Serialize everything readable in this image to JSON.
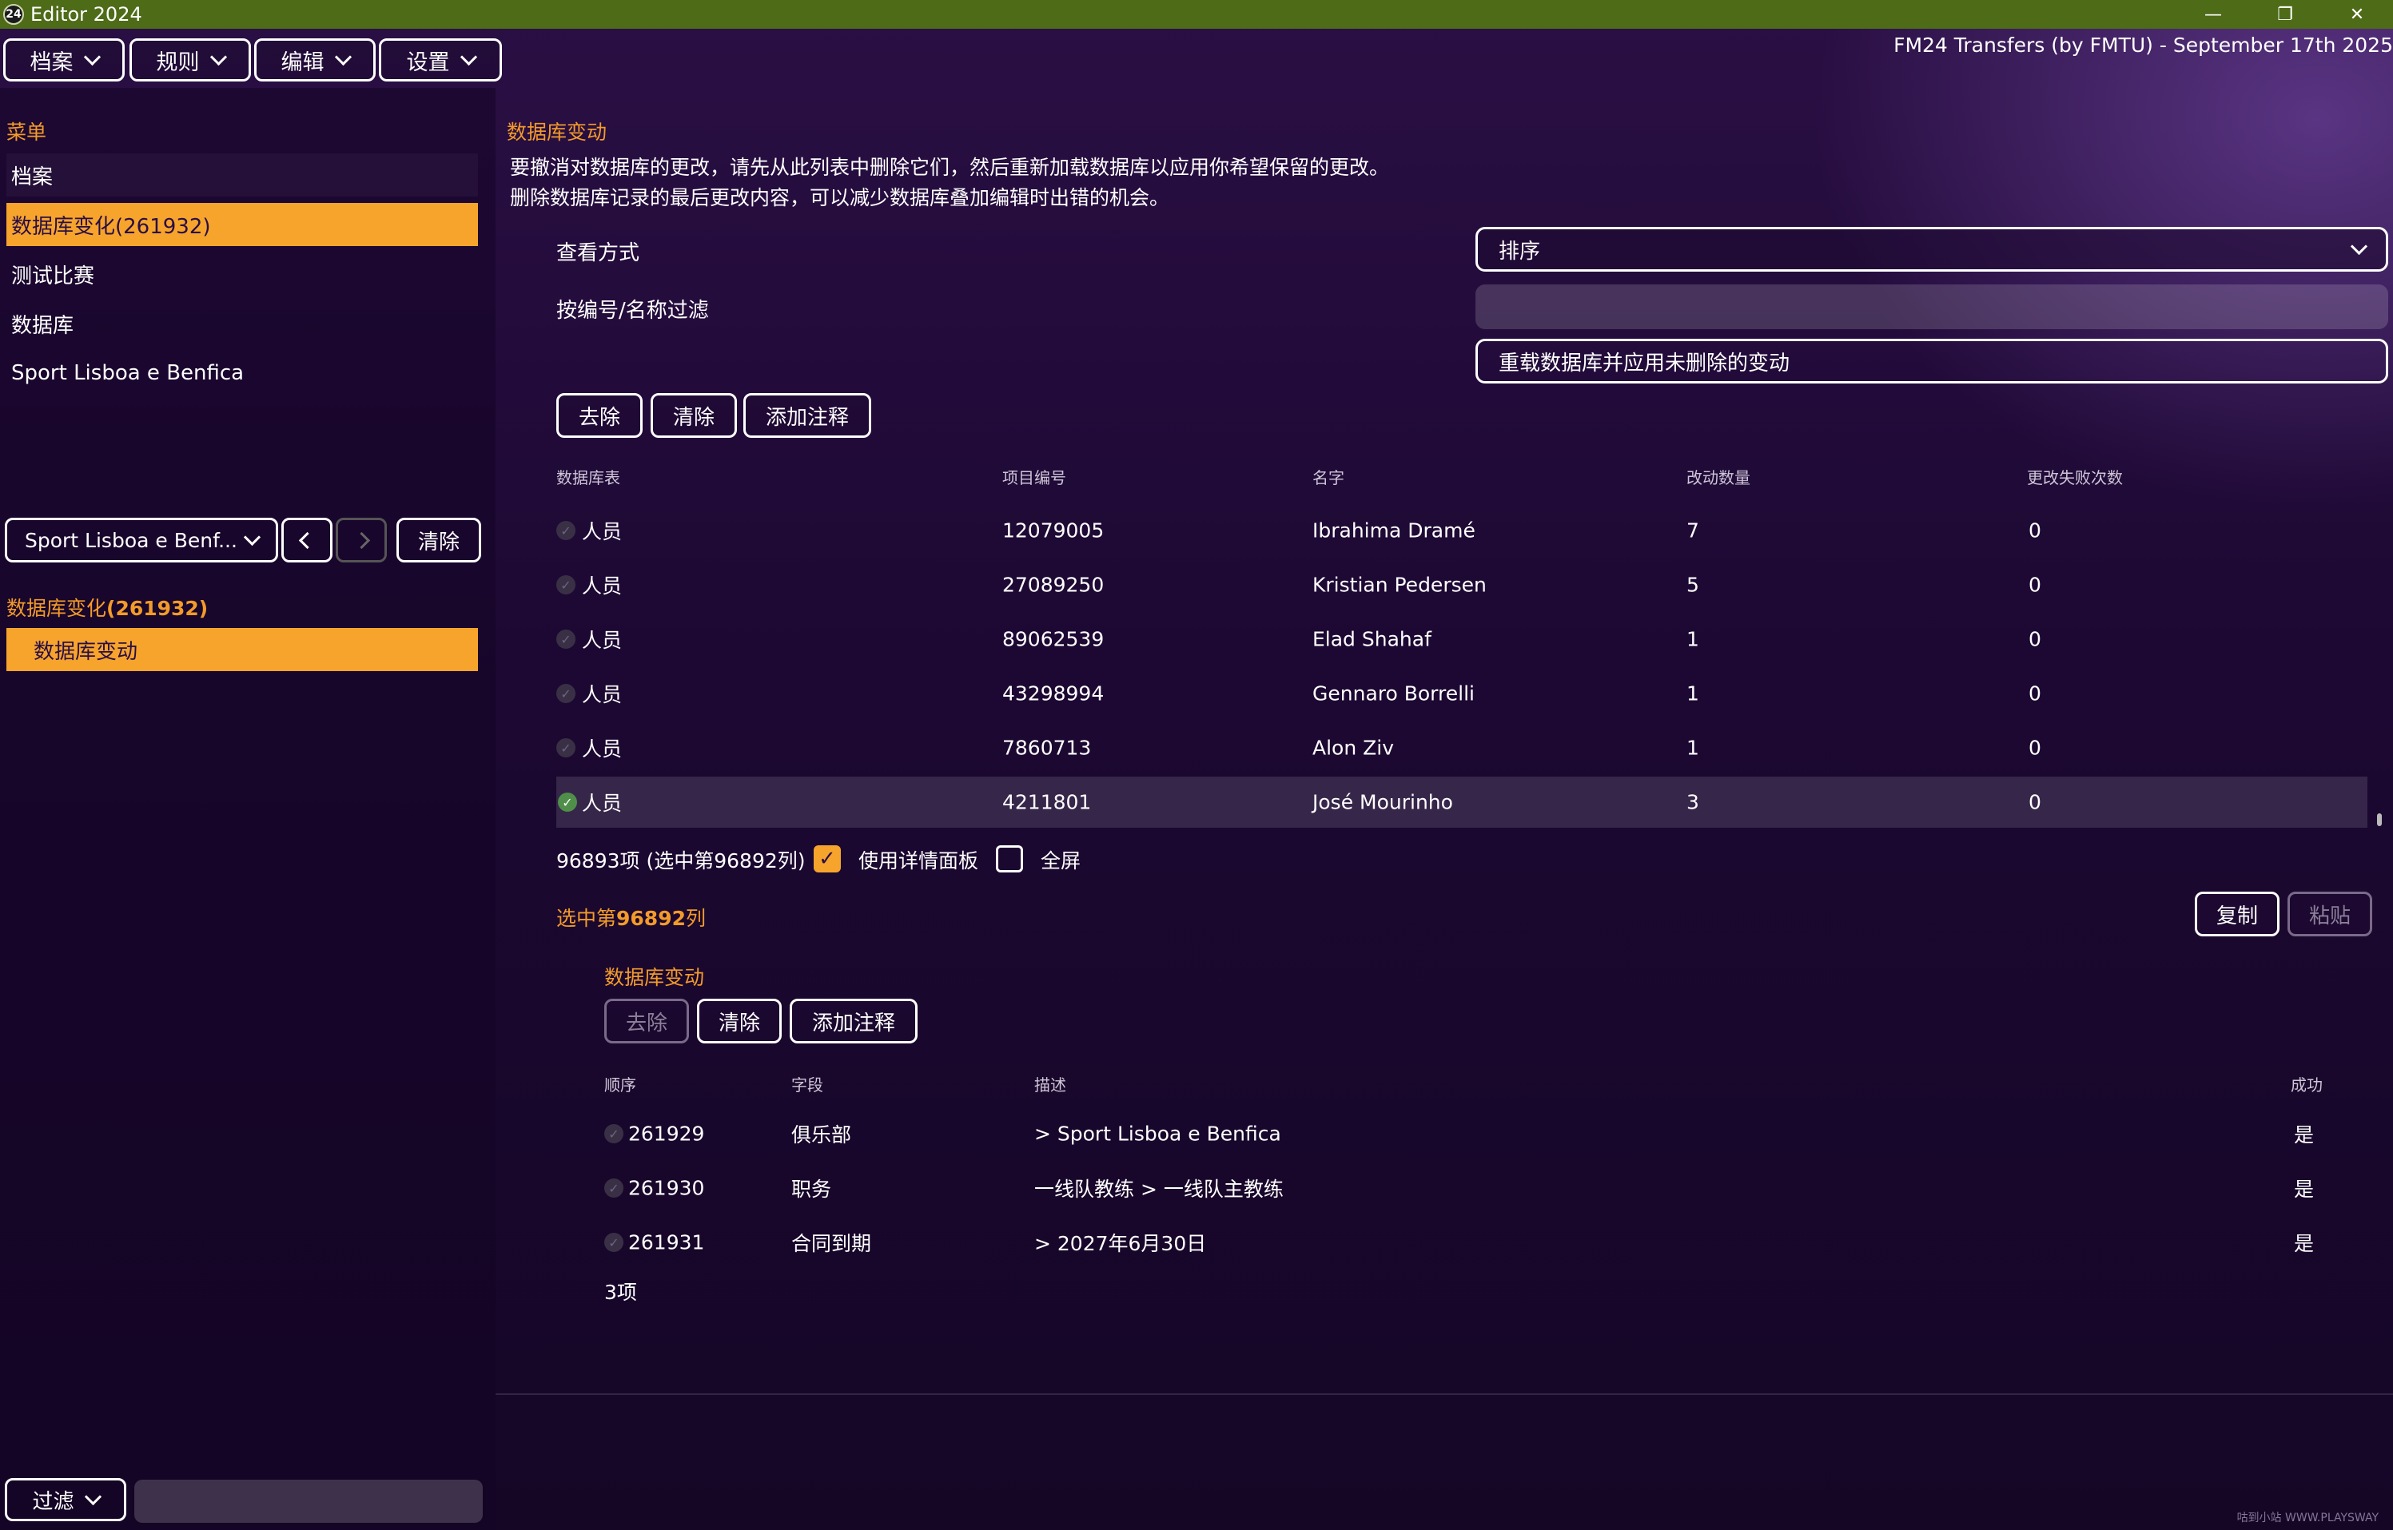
{
  "window": {
    "icon_text": "24",
    "title": "Editor 2024",
    "controls": [
      "—",
      "❐",
      "✕"
    ]
  },
  "menus": [
    {
      "label": "档案"
    },
    {
      "label": "规则"
    },
    {
      "label": "编辑"
    },
    {
      "label": "设置"
    }
  ],
  "header_right": "FM24 Transfers (by FMTU) - September 17th 2025",
  "sidebar": {
    "menu_title": "菜单",
    "items": [
      {
        "label": "档案"
      },
      {
        "label": "数据库变化(261932)"
      },
      {
        "label": "测试比赛"
      },
      {
        "label": "数据库"
      },
      {
        "label": "Sport Lisboa e Benfica"
      }
    ],
    "nav_select": "Sport Lisboa e Benf...",
    "clear_label": "清除",
    "history_title": "数据库变化",
    "history_count": "(261932)",
    "history_item": "数据库变动",
    "filter_label": "过滤"
  },
  "main": {
    "title": "数据库变动",
    "desc_line1": "要撤消对数据库的更改，请先从此列表中删除它们，然后重新加载数据库以应用你希望保留的更改。",
    "desc_line2": "删除数据库记录的最后更改内容，可以减少数据库叠加编辑时出错的机会。",
    "view_label": "查看方式",
    "view_value": "排序",
    "filter_label": "按编号/名称过滤",
    "filter_value": "",
    "reload_label": "重载数据库并应用未删除的变动",
    "buttons": {
      "remove": "去除",
      "clear": "清除",
      "add_note": "添加注释"
    },
    "table": {
      "headers": [
        "数据库表",
        "项目编号",
        "名字",
        "改动数量",
        "更改失败次数"
      ],
      "rows": [
        {
          "table": "人员",
          "id": "12079005",
          "name": "Ibrahima Dramé",
          "changes": "7",
          "failures": "0"
        },
        {
          "table": "人员",
          "id": "27089250",
          "name": "Kristian Pedersen",
          "changes": "5",
          "failures": "0"
        },
        {
          "table": "人员",
          "id": "89062539",
          "name": "Elad Shahaf",
          "changes": "1",
          "failures": "0"
        },
        {
          "table": "人员",
          "id": "43298994",
          "name": "Gennaro Borrelli",
          "changes": "1",
          "failures": "0"
        },
        {
          "table": "人员",
          "id": "7860713",
          "name": "Alon Ziv",
          "changes": "1",
          "failures": "0"
        },
        {
          "table": "人员",
          "id": "4211801",
          "name": "José Mourinho",
          "changes": "3",
          "failures": "0"
        }
      ]
    },
    "count_text": "96893项 (选中第96892列)",
    "use_detail_label": "使用详情面板",
    "use_detail_checked": true,
    "fullscreen_label": "全屏",
    "fullscreen_checked": false,
    "selected_prefix": "选中第",
    "selected_number": "96892",
    "selected_suffix": "列",
    "copy_label": "复制",
    "paste_label": "粘贴",
    "detail": {
      "title": "数据库变动",
      "buttons": {
        "remove": "去除",
        "clear": "清除",
        "add_note": "添加注释"
      },
      "headers": [
        "顺序",
        "字段",
        "描述",
        "成功"
      ],
      "rows": [
        {
          "order": "261929",
          "field": "俱乐部",
          "desc": "> Sport Lisboa e Benfica",
          "success": "是"
        },
        {
          "order": "261930",
          "field": "职务",
          "desc": "一线队教练 > 一线队主教练",
          "success": "是"
        },
        {
          "order": "261931",
          "field": "合同到期",
          "desc": "> 2027年6月30日",
          "success": "是"
        }
      ],
      "count_text": "3项"
    }
  },
  "watermark": "咕到小站 WWW.PLAYSWAY"
}
